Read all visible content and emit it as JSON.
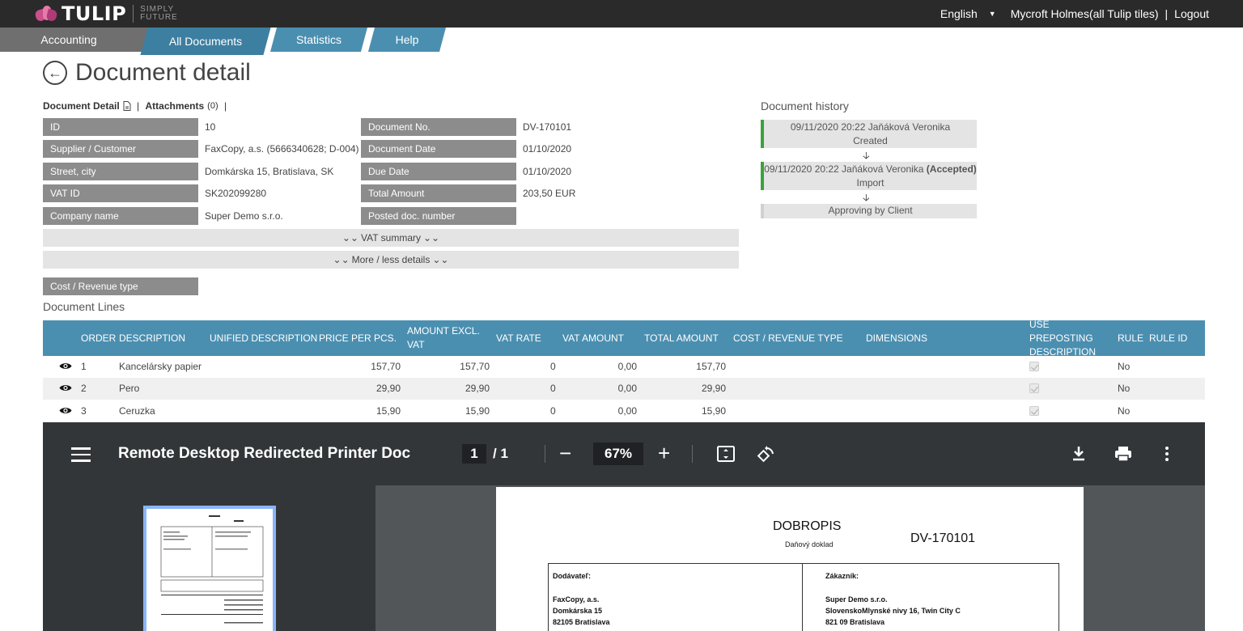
{
  "header": {
    "logo_text": "TULIP",
    "logo_sub_1": "SIMPLY",
    "logo_sub_2": "FUTURE",
    "language": "English",
    "user": "Mycroft Holmes(all Tulip tiles)",
    "logout": "Logout"
  },
  "nav": {
    "tabs": [
      "Accounting",
      "All Documents",
      "Statistics",
      "Help"
    ],
    "active": "All Documents"
  },
  "page": {
    "title": "Document detail",
    "subnav_detail": "Document Detail",
    "subnav_attachments": "Attachments",
    "attachments_count": "(0)"
  },
  "detail": {
    "left": [
      {
        "label": "ID",
        "value": "10"
      },
      {
        "label": "Supplier / Customer",
        "value": "FaxCopy, a.s. (5666340628; D-004)"
      },
      {
        "label": "Street, city",
        "value": "Domkárska 15, Bratislava, SK"
      },
      {
        "label": "VAT ID",
        "value": "SK202099280"
      },
      {
        "label": "Company name",
        "value": "Super Demo s.r.o."
      }
    ],
    "right": [
      {
        "label": "Document No.",
        "value": "DV-170101"
      },
      {
        "label": "Document Date",
        "value": "01/10/2020"
      },
      {
        "label": "Due Date",
        "value": "01/10/2020"
      },
      {
        "label": "Total Amount",
        "value": "203,50 EUR"
      },
      {
        "label": "Posted doc. number",
        "value": ""
      }
    ],
    "vat_summary": "VAT summary",
    "more_less": "More / less details",
    "cost_revenue_label": "Cost / Revenue type"
  },
  "history": {
    "title": "Document history",
    "entries": [
      {
        "line1": "09/11/2020 20:22 Jaňáková Veronika",
        "line1_bold": "",
        "line2": "Created"
      },
      {
        "line1": "09/11/2020 20:22 Jaňáková Veronika ",
        "line1_bold": "(Accepted)",
        "line2": "Import"
      }
    ],
    "pending": "Approving by Client"
  },
  "lines": {
    "title": "Document Lines",
    "columns": [
      "ORDER",
      "DESCRIPTION",
      "UNIFIED DESCRIPTION",
      "PRICE PER PCS.",
      "AMOUNT EXCL. VAT",
      "VAT RATE",
      "VAT AMOUNT",
      "TOTAL AMOUNT",
      "COST / REVENUE TYPE",
      "DIMENSIONS",
      "USE PREPOSTING DESCRIPTION",
      "RULE",
      "RULE ID"
    ],
    "rows": [
      {
        "order": "1",
        "description": "Kancelársky papier",
        "price": "157,70",
        "amount_excl": "157,70",
        "vat_rate": "0",
        "vat_amount": "0,00",
        "total": "157,70",
        "rule": "No"
      },
      {
        "order": "2",
        "description": "Pero",
        "price": "29,90",
        "amount_excl": "29,90",
        "vat_rate": "0",
        "vat_amount": "0,00",
        "total": "29,90",
        "rule": "No"
      },
      {
        "order": "3",
        "description": "Ceruzka",
        "price": "15,90",
        "amount_excl": "15,90",
        "vat_rate": "0",
        "vat_amount": "0,00",
        "total": "15,90",
        "rule": "No"
      }
    ]
  },
  "pdf": {
    "title": "Remote Desktop Redirected Printer Doc",
    "page_current": "1",
    "page_total": "/  1",
    "zoom": "67%",
    "doc_title": "DOBROPIS",
    "doc_subtitle": "Daňový doklad",
    "doc_number": "DV-170101",
    "supplier_label": "Dodávateľ:",
    "supplier_lines": [
      "FaxCopy, a.s.",
      "Domkárska 15",
      "82105 Bratislava"
    ],
    "customer_label": "Zákazník:",
    "customer_lines": [
      "Super Demo s.r.o.",
      "SlovenskoMlynské nivy 16, Twin City C",
      "821 09 Bratislava"
    ]
  },
  "colors": {
    "topbar": "#2a2a2a",
    "tab_active": "#3d7fa0",
    "tab": "#4b8fb0",
    "table_header": "#4b8fb0",
    "label_bg": "#8c8c8c",
    "history_accent": "#3aa33a",
    "pdf_toolbar": "#323639"
  }
}
